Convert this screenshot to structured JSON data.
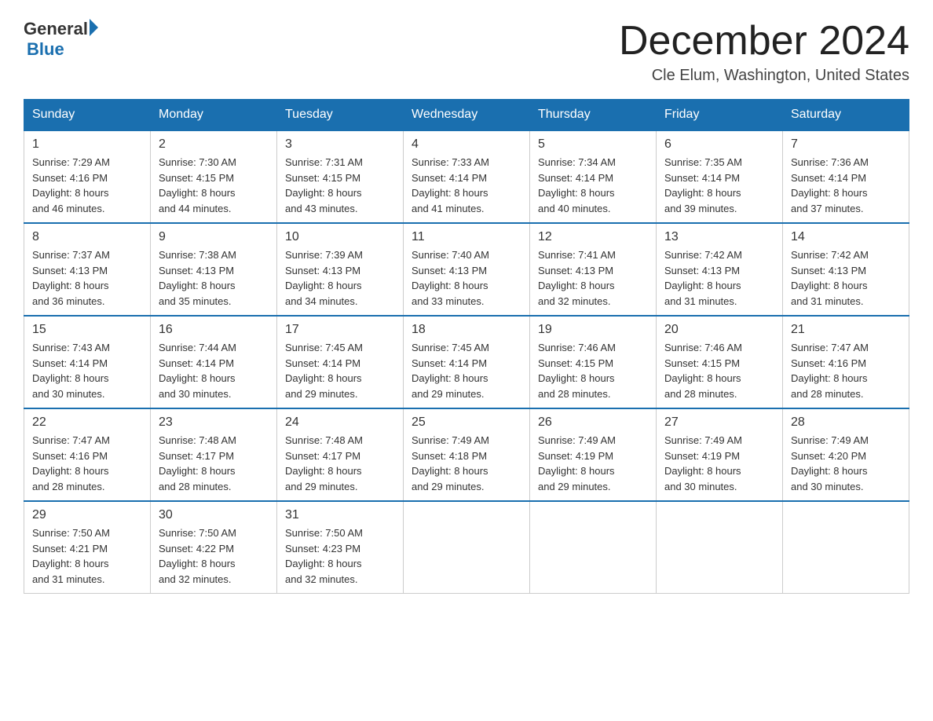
{
  "header": {
    "logo_general": "General",
    "logo_blue": "Blue",
    "month_year": "December 2024",
    "location": "Cle Elum, Washington, United States"
  },
  "days_of_week": [
    "Sunday",
    "Monday",
    "Tuesday",
    "Wednesday",
    "Thursday",
    "Friday",
    "Saturday"
  ],
  "weeks": [
    [
      {
        "day": "1",
        "sunrise": "7:29 AM",
        "sunset": "4:16 PM",
        "daylight": "8 hours and 46 minutes."
      },
      {
        "day": "2",
        "sunrise": "7:30 AM",
        "sunset": "4:15 PM",
        "daylight": "8 hours and 44 minutes."
      },
      {
        "day": "3",
        "sunrise": "7:31 AM",
        "sunset": "4:15 PM",
        "daylight": "8 hours and 43 minutes."
      },
      {
        "day": "4",
        "sunrise": "7:33 AM",
        "sunset": "4:14 PM",
        "daylight": "8 hours and 41 minutes."
      },
      {
        "day": "5",
        "sunrise": "7:34 AM",
        "sunset": "4:14 PM",
        "daylight": "8 hours and 40 minutes."
      },
      {
        "day": "6",
        "sunrise": "7:35 AM",
        "sunset": "4:14 PM",
        "daylight": "8 hours and 39 minutes."
      },
      {
        "day": "7",
        "sunrise": "7:36 AM",
        "sunset": "4:14 PM",
        "daylight": "8 hours and 37 minutes."
      }
    ],
    [
      {
        "day": "8",
        "sunrise": "7:37 AM",
        "sunset": "4:13 PM",
        "daylight": "8 hours and 36 minutes."
      },
      {
        "day": "9",
        "sunrise": "7:38 AM",
        "sunset": "4:13 PM",
        "daylight": "8 hours and 35 minutes."
      },
      {
        "day": "10",
        "sunrise": "7:39 AM",
        "sunset": "4:13 PM",
        "daylight": "8 hours and 34 minutes."
      },
      {
        "day": "11",
        "sunrise": "7:40 AM",
        "sunset": "4:13 PM",
        "daylight": "8 hours and 33 minutes."
      },
      {
        "day": "12",
        "sunrise": "7:41 AM",
        "sunset": "4:13 PM",
        "daylight": "8 hours and 32 minutes."
      },
      {
        "day": "13",
        "sunrise": "7:42 AM",
        "sunset": "4:13 PM",
        "daylight": "8 hours and 31 minutes."
      },
      {
        "day": "14",
        "sunrise": "7:42 AM",
        "sunset": "4:13 PM",
        "daylight": "8 hours and 31 minutes."
      }
    ],
    [
      {
        "day": "15",
        "sunrise": "7:43 AM",
        "sunset": "4:14 PM",
        "daylight": "8 hours and 30 minutes."
      },
      {
        "day": "16",
        "sunrise": "7:44 AM",
        "sunset": "4:14 PM",
        "daylight": "8 hours and 30 minutes."
      },
      {
        "day": "17",
        "sunrise": "7:45 AM",
        "sunset": "4:14 PM",
        "daylight": "8 hours and 29 minutes."
      },
      {
        "day": "18",
        "sunrise": "7:45 AM",
        "sunset": "4:14 PM",
        "daylight": "8 hours and 29 minutes."
      },
      {
        "day": "19",
        "sunrise": "7:46 AM",
        "sunset": "4:15 PM",
        "daylight": "8 hours and 28 minutes."
      },
      {
        "day": "20",
        "sunrise": "7:46 AM",
        "sunset": "4:15 PM",
        "daylight": "8 hours and 28 minutes."
      },
      {
        "day": "21",
        "sunrise": "7:47 AM",
        "sunset": "4:16 PM",
        "daylight": "8 hours and 28 minutes."
      }
    ],
    [
      {
        "day": "22",
        "sunrise": "7:47 AM",
        "sunset": "4:16 PM",
        "daylight": "8 hours and 28 minutes."
      },
      {
        "day": "23",
        "sunrise": "7:48 AM",
        "sunset": "4:17 PM",
        "daylight": "8 hours and 28 minutes."
      },
      {
        "day": "24",
        "sunrise": "7:48 AM",
        "sunset": "4:17 PM",
        "daylight": "8 hours and 29 minutes."
      },
      {
        "day": "25",
        "sunrise": "7:49 AM",
        "sunset": "4:18 PM",
        "daylight": "8 hours and 29 minutes."
      },
      {
        "day": "26",
        "sunrise": "7:49 AM",
        "sunset": "4:19 PM",
        "daylight": "8 hours and 29 minutes."
      },
      {
        "day": "27",
        "sunrise": "7:49 AM",
        "sunset": "4:19 PM",
        "daylight": "8 hours and 30 minutes."
      },
      {
        "day": "28",
        "sunrise": "7:49 AM",
        "sunset": "4:20 PM",
        "daylight": "8 hours and 30 minutes."
      }
    ],
    [
      {
        "day": "29",
        "sunrise": "7:50 AM",
        "sunset": "4:21 PM",
        "daylight": "8 hours and 31 minutes."
      },
      {
        "day": "30",
        "sunrise": "7:50 AM",
        "sunset": "4:22 PM",
        "daylight": "8 hours and 32 minutes."
      },
      {
        "day": "31",
        "sunrise": "7:50 AM",
        "sunset": "4:23 PM",
        "daylight": "8 hours and 32 minutes."
      },
      null,
      null,
      null,
      null
    ]
  ],
  "labels": {
    "sunrise": "Sunrise:",
    "sunset": "Sunset:",
    "daylight": "Daylight:"
  }
}
